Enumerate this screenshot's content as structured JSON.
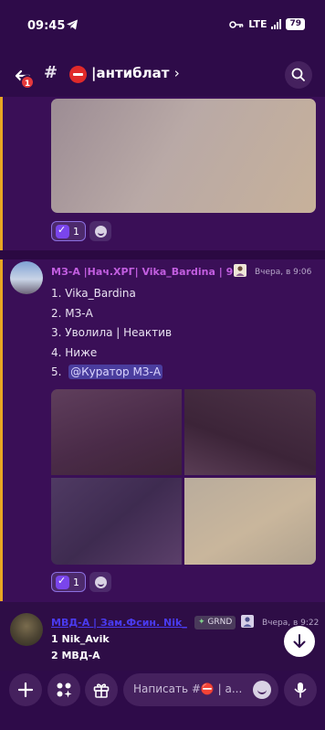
{
  "status_bar": {
    "time": "09:45",
    "network": "LTE",
    "battery": "79"
  },
  "header": {
    "back_badge": "1",
    "channel_name": "|антиблат",
    "chevron": "›"
  },
  "messages": [
    {
      "reaction_count": "1"
    },
    {
      "author": "МЗ-А |Нач.ХРГ| Vika_Bardina | 9",
      "timestamp": "Вчера, в 9:06",
      "list": [
        "1.  Vika_Bardina",
        "2.  МЗ-А",
        "3.  Уволила | Неактив",
        "4.  Ниже",
        "5."
      ],
      "mention": "@Куратор МЗ-А",
      "reaction_count": "1"
    },
    {
      "author": "МВД-А | Зам.Фсин. Nik_",
      "tag": "GRND",
      "timestamp": "Вчера, в 9:22",
      "lines": [
        "1 Nik_Avik",
        "2 МВД-А"
      ]
    }
  ],
  "composer": {
    "placeholder": "Написать #⛔ | а..."
  },
  "colors": {
    "accent": "#e8a623",
    "author_purple": "#c25ee0",
    "author_blue": "#4a3bf0"
  }
}
